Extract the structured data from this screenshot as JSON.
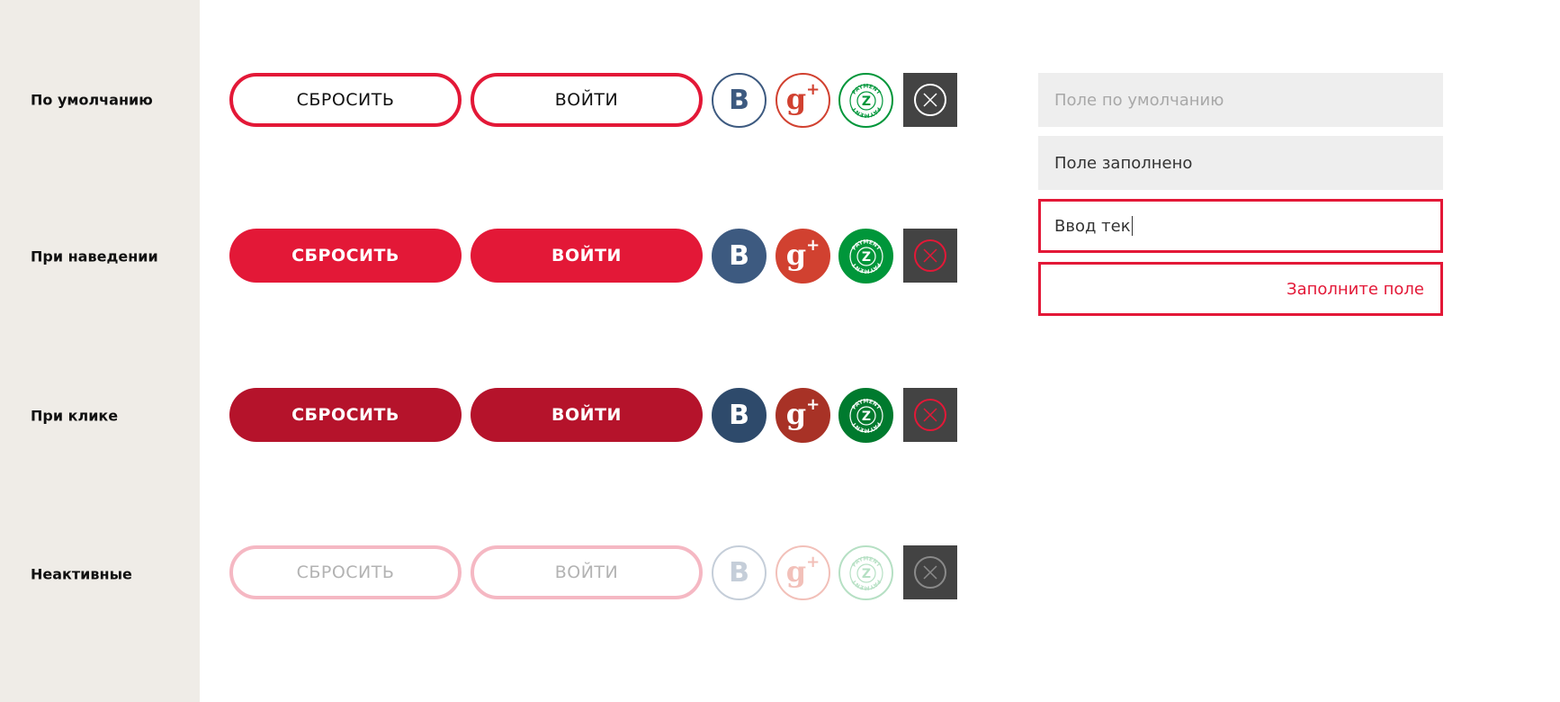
{
  "states": [
    {
      "label": "По умолчанию",
      "key": "default"
    },
    {
      "label": "При наведении",
      "key": "hover"
    },
    {
      "label": "При клике",
      "key": "click"
    },
    {
      "label": "Неактивные",
      "key": "disabled"
    }
  ],
  "buttons": {
    "reset_label": "СБРОСИТЬ",
    "login_label": "ВОЙТИ"
  },
  "social": {
    "vk_glyph": "B",
    "gplus_glyph": "g",
    "gplus_plus": "+",
    "payment_glyph": "Z",
    "payment_ring_text": "PAYMENT"
  },
  "icons": [
    "vk-icon",
    "google-plus-icon",
    "payment-icon",
    "close-icon"
  ],
  "colors": {
    "accent": "#e31837",
    "accent_pressed": "#b5132b",
    "vk": "#3d5a80",
    "gplus": "#d14130",
    "payment": "#00963a",
    "close_bg": "#434343",
    "field_bg": "#eeeeee",
    "sidebar_bg": "#efece7"
  },
  "fields": {
    "default_placeholder": "Поле по умолчанию",
    "filled_value": "Поле заполнено",
    "typing_value": "Ввод тек",
    "error_message": "Заполните поле"
  }
}
